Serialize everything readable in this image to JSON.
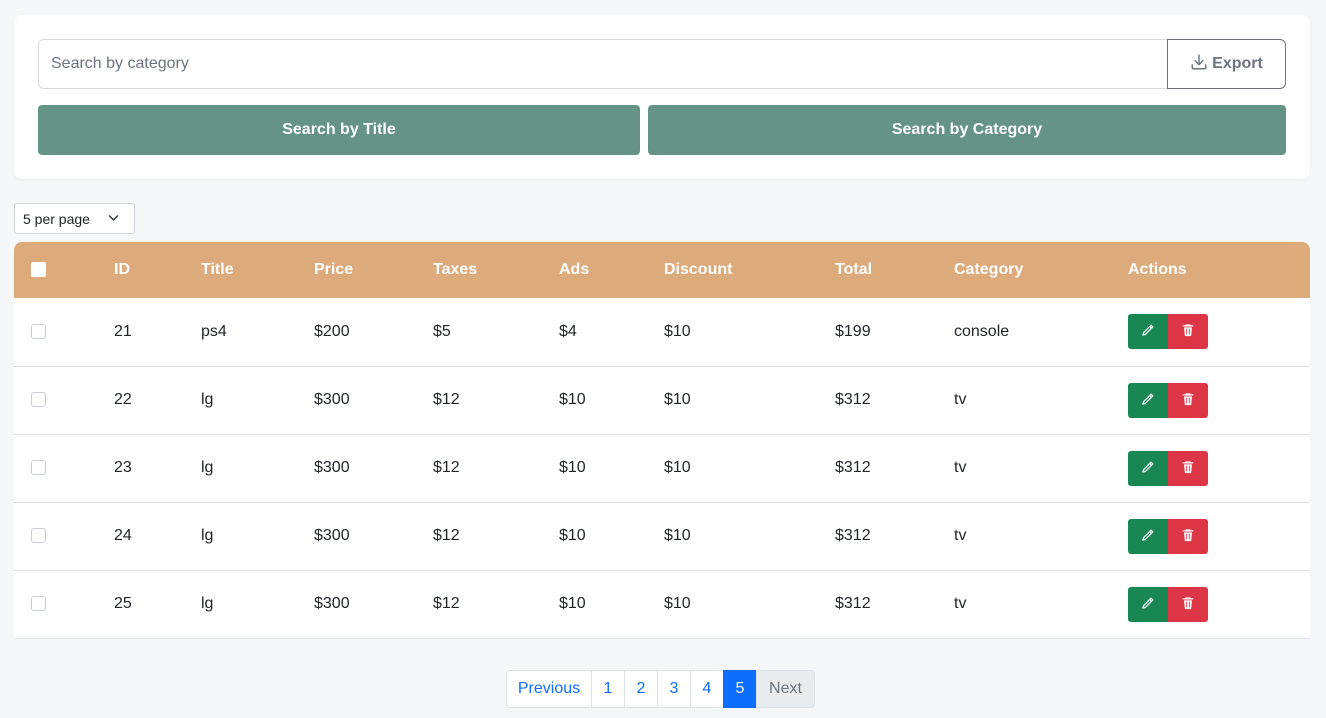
{
  "search": {
    "placeholder": "Search by category",
    "export_label": "Export",
    "by_title_label": "Search by Title",
    "by_category_label": "Search by Category"
  },
  "per_page": {
    "selected": "5 per page"
  },
  "table": {
    "headers": [
      "ID",
      "Title",
      "Price",
      "Taxes",
      "Ads",
      "Discount",
      "Total",
      "Category",
      "Actions"
    ],
    "rows": [
      {
        "id": "21",
        "title": "ps4",
        "price": "$200",
        "taxes": "$5",
        "ads": "$4",
        "discount": "$10",
        "total": "$199",
        "category": "console"
      },
      {
        "id": "22",
        "title": "lg",
        "price": "$300",
        "taxes": "$12",
        "ads": "$10",
        "discount": "$10",
        "total": "$312",
        "category": "tv"
      },
      {
        "id": "23",
        "title": "lg",
        "price": "$300",
        "taxes": "$12",
        "ads": "$10",
        "discount": "$10",
        "total": "$312",
        "category": "tv"
      },
      {
        "id": "24",
        "title": "lg",
        "price": "$300",
        "taxes": "$12",
        "ads": "$10",
        "discount": "$10",
        "total": "$312",
        "category": "tv"
      },
      {
        "id": "25",
        "title": "lg",
        "price": "$300",
        "taxes": "$12",
        "ads": "$10",
        "discount": "$10",
        "total": "$312",
        "category": "tv"
      }
    ]
  },
  "pagination": {
    "previous": "Previous",
    "pages": [
      "1",
      "2",
      "3",
      "4",
      "5"
    ],
    "active_page": "5",
    "next": "Next"
  },
  "icons": {
    "export": "download-icon",
    "per_page": "chevron-down-icon",
    "edit": "pencil-icon",
    "delete": "trash-icon"
  },
  "colors": {
    "search_buttons": "#659386",
    "table_header": "#dcaa7b",
    "edit": "#198754",
    "delete": "#dc3545",
    "active_page": "#0d6efd"
  }
}
